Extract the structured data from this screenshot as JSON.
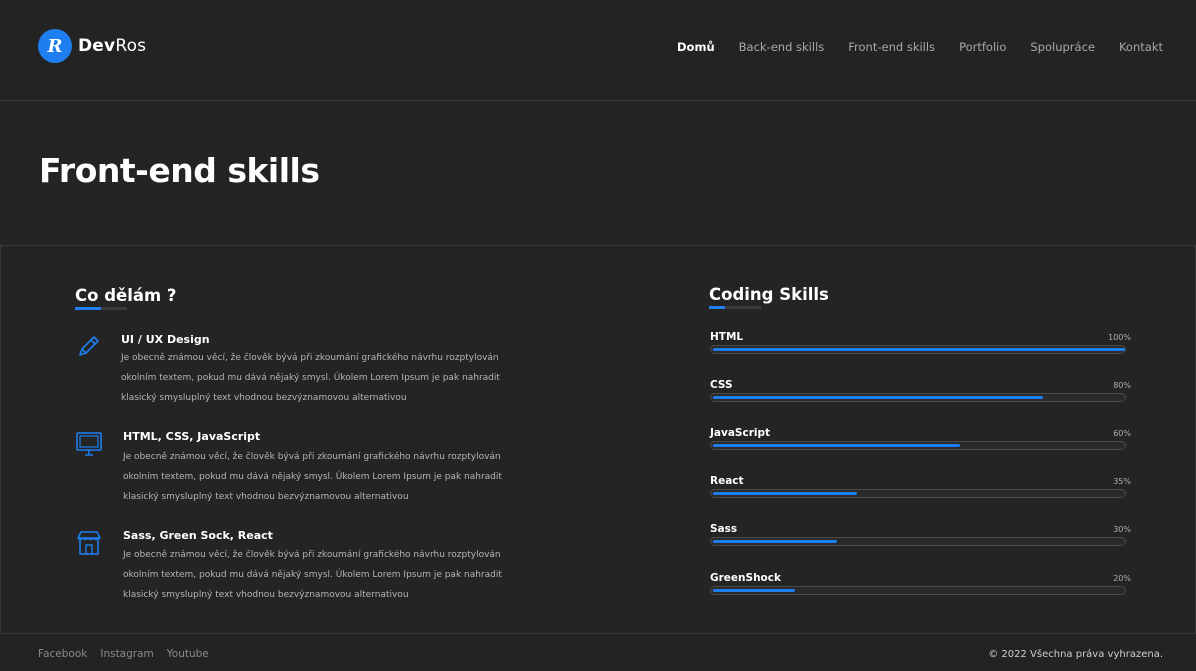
{
  "brand": {
    "initial": "R",
    "name_strong": "Dev",
    "name_light": "Ros"
  },
  "nav": {
    "items": [
      {
        "label": "Domů",
        "active": true
      },
      {
        "label": "Back-end skills"
      },
      {
        "label": "Front-end skills"
      },
      {
        "label": "Portfolio"
      },
      {
        "label": "Spolupráce"
      },
      {
        "label": "Kontakt"
      }
    ]
  },
  "hero": {
    "title": "Front-end skills"
  },
  "services": {
    "title": "Co dělám ?",
    "items": [
      {
        "icon": "pencil-icon",
        "title": "UI / UX Design",
        "lines": [
          "Je obecně známou věcí, že člověk bývá při zkoumání grafického návrhu rozptylován",
          "okolním textem, pokud mu dává nějaký smysl. Úkolem Lorem Ipsum je pak nahradit",
          "klasický smysluplný text vhodnou bezvýznamovou alternativou"
        ]
      },
      {
        "icon": "monitor-icon",
        "title": "HTML, CSS, JavaScript",
        "lines": [
          "Je obecně známou věcí, že člověk bývá při zkoumání grafického návrhu rozptylován",
          "okolním textem, pokud mu dává nějaký smysl. Úkolem Lorem Ipsum je pak nahradit",
          "klasický smysluplný text vhodnou bezvýznamovou alternativou"
        ]
      },
      {
        "icon": "store-icon",
        "title": "Sass,  Green Sock, React",
        "lines": [
          "Je obecně známou věcí, že člověk bývá při zkoumání grafického návrhu rozptylován",
          "okolním textem, pokud mu dává nějaký smysl. Úkolem Lorem Ipsum je pak nahradit",
          "klasický smysluplný text vhodnou bezvýznamovou alternativou"
        ]
      }
    ]
  },
  "skills": {
    "title": "Coding Skills",
    "items": [
      {
        "name": "HTML",
        "percent_label": "100%",
        "level": 1.0
      },
      {
        "name": "CSS",
        "percent_label": "80%",
        "level": 0.8
      },
      {
        "name": "JavaScript",
        "percent_label": "60%",
        "level": 0.6
      },
      {
        "name": "React",
        "percent_label": "35%",
        "level": 0.35
      },
      {
        "name": "Sass",
        "percent_label": "30%",
        "level": 0.3
      },
      {
        "name": "GreenShock",
        "percent_label": "20%",
        "level": 0.2
      }
    ]
  },
  "footer": {
    "links": [
      "Facebook",
      "Instagram",
      "Youtube"
    ],
    "copyright": "© 2022 Všechna práva vyhrazena."
  },
  "colors": {
    "accent": "#1e7ef0",
    "background": "#242424"
  }
}
